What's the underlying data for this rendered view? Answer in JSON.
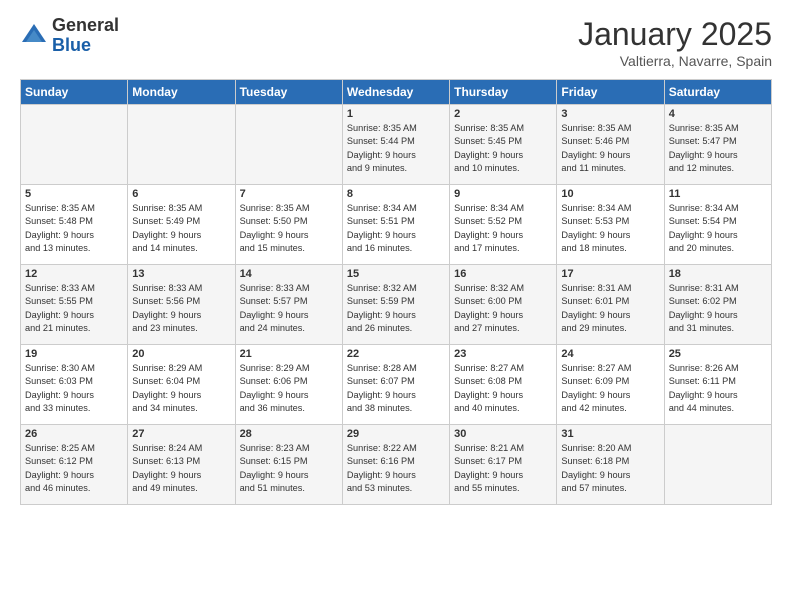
{
  "logo": {
    "general": "General",
    "blue": "Blue"
  },
  "header": {
    "month": "January 2025",
    "location": "Valtierra, Navarre, Spain"
  },
  "weekdays": [
    "Sunday",
    "Monday",
    "Tuesday",
    "Wednesday",
    "Thursday",
    "Friday",
    "Saturday"
  ],
  "weeks": [
    [
      {
        "day": "",
        "info": ""
      },
      {
        "day": "",
        "info": ""
      },
      {
        "day": "",
        "info": ""
      },
      {
        "day": "1",
        "info": "Sunrise: 8:35 AM\nSunset: 5:44 PM\nDaylight: 9 hours\nand 9 minutes."
      },
      {
        "day": "2",
        "info": "Sunrise: 8:35 AM\nSunset: 5:45 PM\nDaylight: 9 hours\nand 10 minutes."
      },
      {
        "day": "3",
        "info": "Sunrise: 8:35 AM\nSunset: 5:46 PM\nDaylight: 9 hours\nand 11 minutes."
      },
      {
        "day": "4",
        "info": "Sunrise: 8:35 AM\nSunset: 5:47 PM\nDaylight: 9 hours\nand 12 minutes."
      }
    ],
    [
      {
        "day": "5",
        "info": "Sunrise: 8:35 AM\nSunset: 5:48 PM\nDaylight: 9 hours\nand 13 minutes."
      },
      {
        "day": "6",
        "info": "Sunrise: 8:35 AM\nSunset: 5:49 PM\nDaylight: 9 hours\nand 14 minutes."
      },
      {
        "day": "7",
        "info": "Sunrise: 8:35 AM\nSunset: 5:50 PM\nDaylight: 9 hours\nand 15 minutes."
      },
      {
        "day": "8",
        "info": "Sunrise: 8:34 AM\nSunset: 5:51 PM\nDaylight: 9 hours\nand 16 minutes."
      },
      {
        "day": "9",
        "info": "Sunrise: 8:34 AM\nSunset: 5:52 PM\nDaylight: 9 hours\nand 17 minutes."
      },
      {
        "day": "10",
        "info": "Sunrise: 8:34 AM\nSunset: 5:53 PM\nDaylight: 9 hours\nand 18 minutes."
      },
      {
        "day": "11",
        "info": "Sunrise: 8:34 AM\nSunset: 5:54 PM\nDaylight: 9 hours\nand 20 minutes."
      }
    ],
    [
      {
        "day": "12",
        "info": "Sunrise: 8:33 AM\nSunset: 5:55 PM\nDaylight: 9 hours\nand 21 minutes."
      },
      {
        "day": "13",
        "info": "Sunrise: 8:33 AM\nSunset: 5:56 PM\nDaylight: 9 hours\nand 23 minutes."
      },
      {
        "day": "14",
        "info": "Sunrise: 8:33 AM\nSunset: 5:57 PM\nDaylight: 9 hours\nand 24 minutes."
      },
      {
        "day": "15",
        "info": "Sunrise: 8:32 AM\nSunset: 5:59 PM\nDaylight: 9 hours\nand 26 minutes."
      },
      {
        "day": "16",
        "info": "Sunrise: 8:32 AM\nSunset: 6:00 PM\nDaylight: 9 hours\nand 27 minutes."
      },
      {
        "day": "17",
        "info": "Sunrise: 8:31 AM\nSunset: 6:01 PM\nDaylight: 9 hours\nand 29 minutes."
      },
      {
        "day": "18",
        "info": "Sunrise: 8:31 AM\nSunset: 6:02 PM\nDaylight: 9 hours\nand 31 minutes."
      }
    ],
    [
      {
        "day": "19",
        "info": "Sunrise: 8:30 AM\nSunset: 6:03 PM\nDaylight: 9 hours\nand 33 minutes."
      },
      {
        "day": "20",
        "info": "Sunrise: 8:29 AM\nSunset: 6:04 PM\nDaylight: 9 hours\nand 34 minutes."
      },
      {
        "day": "21",
        "info": "Sunrise: 8:29 AM\nSunset: 6:06 PM\nDaylight: 9 hours\nand 36 minutes."
      },
      {
        "day": "22",
        "info": "Sunrise: 8:28 AM\nSunset: 6:07 PM\nDaylight: 9 hours\nand 38 minutes."
      },
      {
        "day": "23",
        "info": "Sunrise: 8:27 AM\nSunset: 6:08 PM\nDaylight: 9 hours\nand 40 minutes."
      },
      {
        "day": "24",
        "info": "Sunrise: 8:27 AM\nSunset: 6:09 PM\nDaylight: 9 hours\nand 42 minutes."
      },
      {
        "day": "25",
        "info": "Sunrise: 8:26 AM\nSunset: 6:11 PM\nDaylight: 9 hours\nand 44 minutes."
      }
    ],
    [
      {
        "day": "26",
        "info": "Sunrise: 8:25 AM\nSunset: 6:12 PM\nDaylight: 9 hours\nand 46 minutes."
      },
      {
        "day": "27",
        "info": "Sunrise: 8:24 AM\nSunset: 6:13 PM\nDaylight: 9 hours\nand 49 minutes."
      },
      {
        "day": "28",
        "info": "Sunrise: 8:23 AM\nSunset: 6:15 PM\nDaylight: 9 hours\nand 51 minutes."
      },
      {
        "day": "29",
        "info": "Sunrise: 8:22 AM\nSunset: 6:16 PM\nDaylight: 9 hours\nand 53 minutes."
      },
      {
        "day": "30",
        "info": "Sunrise: 8:21 AM\nSunset: 6:17 PM\nDaylight: 9 hours\nand 55 minutes."
      },
      {
        "day": "31",
        "info": "Sunrise: 8:20 AM\nSunset: 6:18 PM\nDaylight: 9 hours\nand 57 minutes."
      },
      {
        "day": "",
        "info": ""
      }
    ]
  ]
}
